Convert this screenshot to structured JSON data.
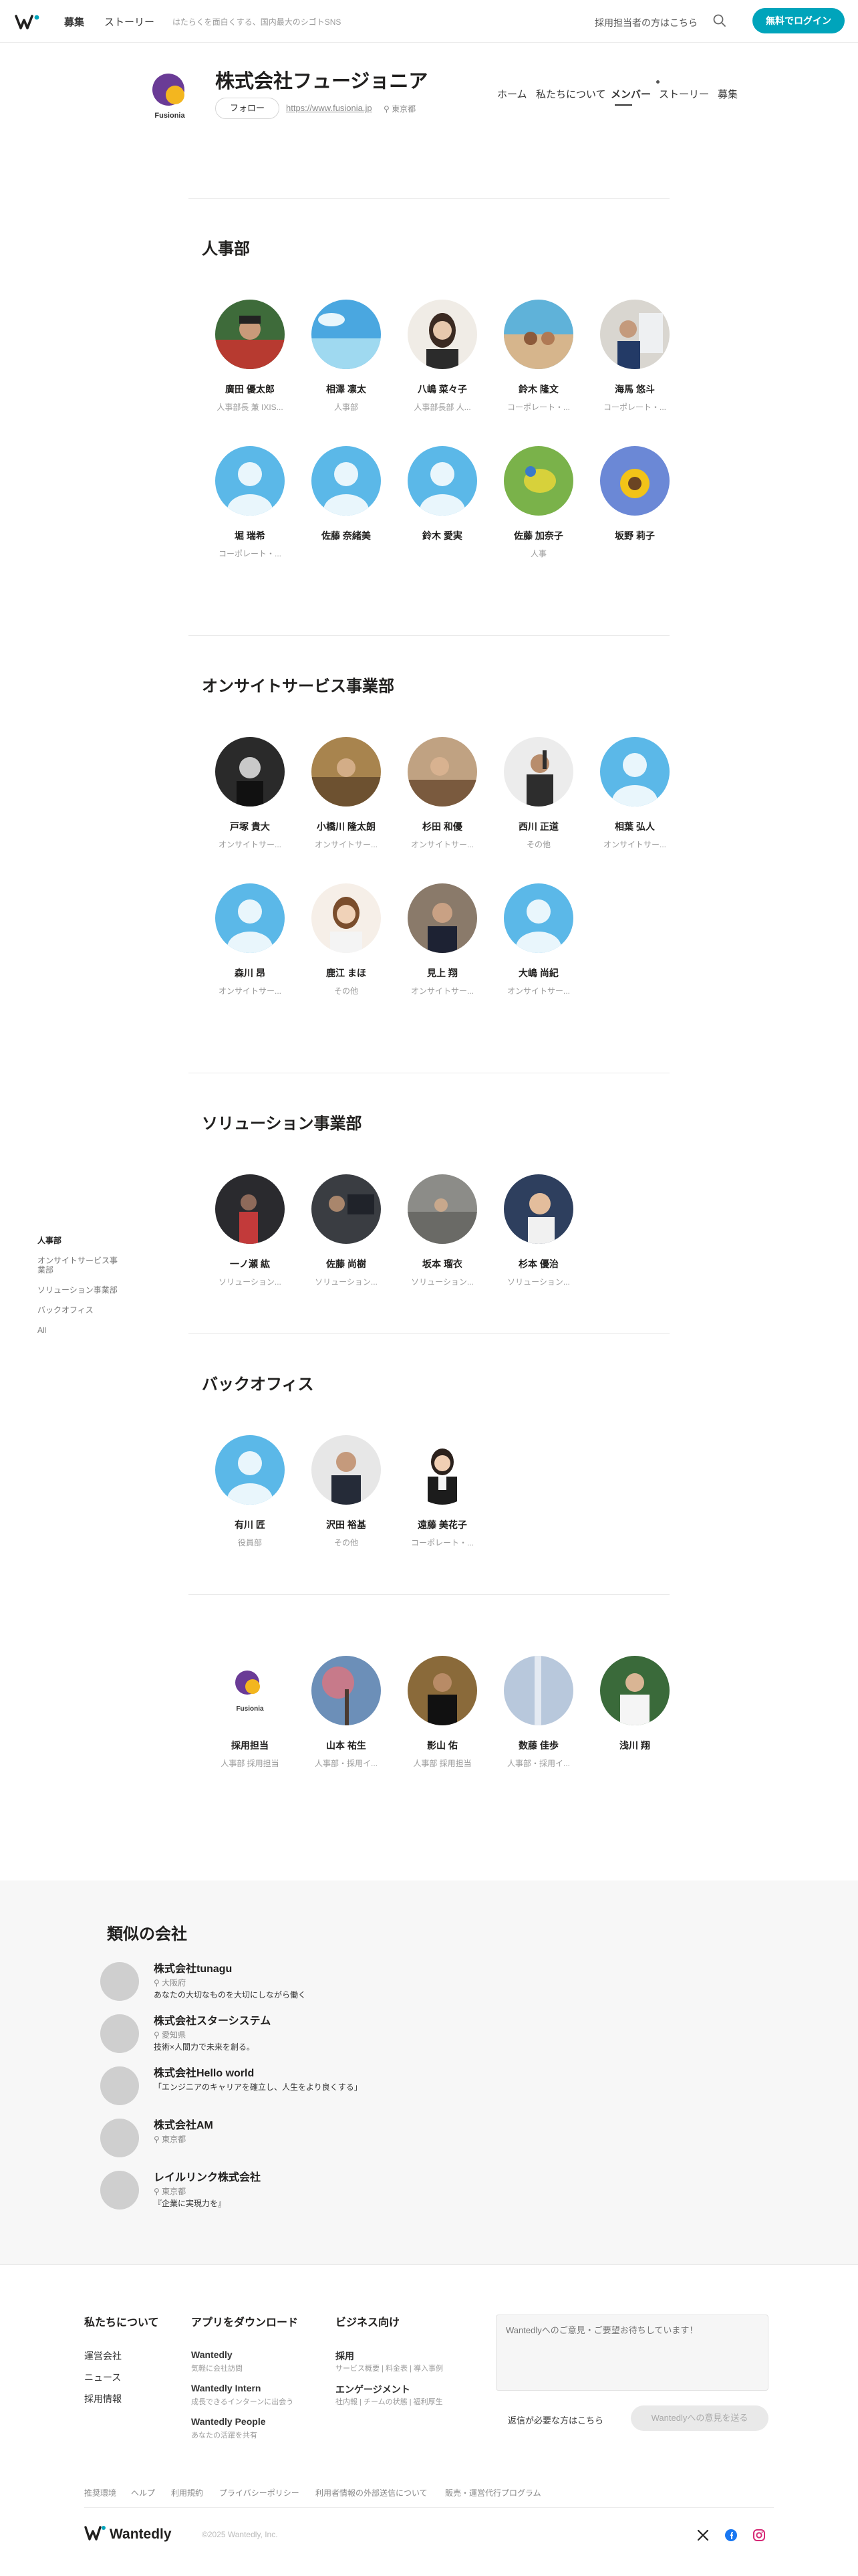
{
  "topnav": {
    "links": [
      "募集",
      "ストーリー"
    ],
    "tagline": "はたらくを面白くする、国内最大のシゴトSNS",
    "recruiter_link": "採用担当者の方はこちら",
    "login_label": "無料でログイン"
  },
  "company": {
    "logo_text": "Fusionia",
    "name": "株式会社フュージョニア",
    "follow_label": "フォロー",
    "url": "https://www.fusionia.jp",
    "location": "東京都",
    "tabs": [
      "ホーム",
      "私たちについて",
      "メンバー",
      "ストーリー",
      "募集"
    ],
    "active_tab": "メンバー"
  },
  "sidebar": {
    "items": [
      "人事部",
      "オンサイトサービス事業部",
      "ソリューション事業部",
      "バックオフィス",
      "All"
    ],
    "active": "人事部"
  },
  "sections": [
    {
      "title": "人事部",
      "members": [
        {
          "name": "廣田 優太郎",
          "role": "人事部長 兼 IXIS...",
          "avatar": "photo-red"
        },
        {
          "name": "相澤 凛太",
          "role": "人事部",
          "avatar": "photo-sky"
        },
        {
          "name": "八嶋 菜々子",
          "role": "人事部長部 人...",
          "avatar": "photo-woman"
        },
        {
          "name": "鈴木 隆文",
          "role": "コーポレート・...",
          "avatar": "photo-beach"
        },
        {
          "name": "海馬 悠斗",
          "role": "コーポレート・...",
          "avatar": "photo-office"
        },
        {
          "name": "堀 瑞希",
          "role": "コーポレート・...",
          "avatar": "default"
        },
        {
          "name": "佐藤 奈緒美",
          "role": "",
          "avatar": "default"
        },
        {
          "name": "鈴木 愛実",
          "role": "",
          "avatar": "default"
        },
        {
          "name": "佐藤 加奈子",
          "role": "人事",
          "avatar": "photo-bird"
        },
        {
          "name": "坂野 莉子",
          "role": "",
          "avatar": "photo-sunflower"
        }
      ]
    },
    {
      "title": "オンサイトサービス事業部",
      "members": [
        {
          "name": "戸塚 貴大",
          "role": "オンサイトサー...",
          "avatar": "photo-dark"
        },
        {
          "name": "小橋川 隆太朗",
          "role": "オンサイトサー...",
          "avatar": "photo-cafe"
        },
        {
          "name": "杉田 和優",
          "role": "オンサイトサー...",
          "avatar": "photo-desk"
        },
        {
          "name": "西川 正道",
          "role": "その他",
          "avatar": "photo-man-grey"
        },
        {
          "name": "相葉 弘人",
          "role": "オンサイトサー...",
          "avatar": "default"
        },
        {
          "name": "森川 昂",
          "role": "オンサイトサー...",
          "avatar": "default"
        },
        {
          "name": "鹿江 まほ",
          "role": "その他",
          "avatar": "photo-woman-light"
        },
        {
          "name": "見上 翔",
          "role": "オンサイトサー...",
          "avatar": "photo-suit"
        },
        {
          "name": "大嶋 尚紀",
          "role": "オンサイトサー...",
          "avatar": "default"
        }
      ]
    },
    {
      "title": "ソリューション事業部",
      "members": [
        {
          "name": "一ノ瀬 紘",
          "role": "ソリューション...",
          "avatar": "photo-night"
        },
        {
          "name": "佐藤 尚樹",
          "role": "ソリューション...",
          "avatar": "photo-pc"
        },
        {
          "name": "坂本 瑠衣",
          "role": "ソリューション...",
          "avatar": "photo-street"
        },
        {
          "name": "杉本 優治",
          "role": "ソリューション...",
          "avatar": "photo-smile"
        }
      ]
    },
    {
      "title": "バックオフィス",
      "members": [
        {
          "name": "有川 匠",
          "role": "役員部",
          "avatar": "default"
        },
        {
          "name": "沢田 裕基",
          "role": "その他",
          "avatar": "photo-suit2"
        },
        {
          "name": "遠藤 美花子",
          "role": "コーポレート・...",
          "avatar": "photo-woman-suit"
        }
      ]
    },
    {
      "title": "",
      "members": [
        {
          "name": "採用担当",
          "role": "人事部 採用担当",
          "avatar": "logo"
        },
        {
          "name": "山本 祐生",
          "role": "人事部・採用イ...",
          "avatar": "photo-tree"
        },
        {
          "name": "影山 佑",
          "role": "人事部 採用担当",
          "avatar": "photo-man-dark"
        },
        {
          "name": "数藤 佳歩",
          "role": "人事部・採用イ...",
          "avatar": "photo-sky2"
        },
        {
          "name": "浅川 翔",
          "role": "",
          "avatar": "photo-shirt"
        }
      ]
    }
  ],
  "similar": {
    "title": "類似の会社",
    "items": [
      {
        "name": "株式会社tunagu",
        "location": "大阪府",
        "desc": "あなたの大切なものを大切にしながら働く"
      },
      {
        "name": "株式会社スターシステム",
        "location": "愛知県",
        "desc": "技術×人間力で未来を創る。"
      },
      {
        "name": "株式会社Hello world",
        "location": "",
        "desc": "「エンジニアのキャリアを確立し、人生をより良くする」"
      },
      {
        "name": "株式会社AM",
        "location": "東京都",
        "desc": ""
      },
      {
        "name": "レイルリンク株式会社",
        "location": "東京都",
        "desc": "『企業に実現力を』"
      }
    ]
  },
  "footer": {
    "about": {
      "heading": "私たちについて",
      "links": [
        "運営会社",
        "ニュース",
        "採用情報"
      ]
    },
    "apps": {
      "heading": "アプリをダウンロード",
      "items": [
        {
          "name": "Wantedly",
          "sub": "気軽に会社訪問"
        },
        {
          "name": "Wantedly Intern",
          "sub": "成長できるインターンに出会う"
        },
        {
          "name": "Wantedly People",
          "sub": "あなたの活躍を共有"
        }
      ]
    },
    "business": {
      "heading": "ビジネス向け",
      "items": [
        {
          "name": "採用",
          "sub": "サービス概要 | 料金表 | 導入事例"
        },
        {
          "name": "エンゲージメント",
          "sub": "社内報 | チームの状態 | 福利厚生"
        }
      ]
    },
    "feedback_placeholder": "Wantedlyへのご意見・ご要望お待ちしています！",
    "reply_link": "返信が必要な方はこちら",
    "send_label": "Wantedlyへの意見を送る",
    "legal": [
      "推奨環境",
      "ヘルプ",
      "利用規約",
      "プライバシーポリシー",
      "利用者情報の外部送信について",
      "販売・運営代行プログラム"
    ],
    "logo_text": "Wantedly",
    "copyright": "©2025 Wantedly, Inc.",
    "social": [
      "x-icon",
      "facebook-icon",
      "instagram-icon"
    ]
  },
  "colors": {
    "accent": "#00a4bb",
    "avatar_default": "#5bb8e8"
  }
}
